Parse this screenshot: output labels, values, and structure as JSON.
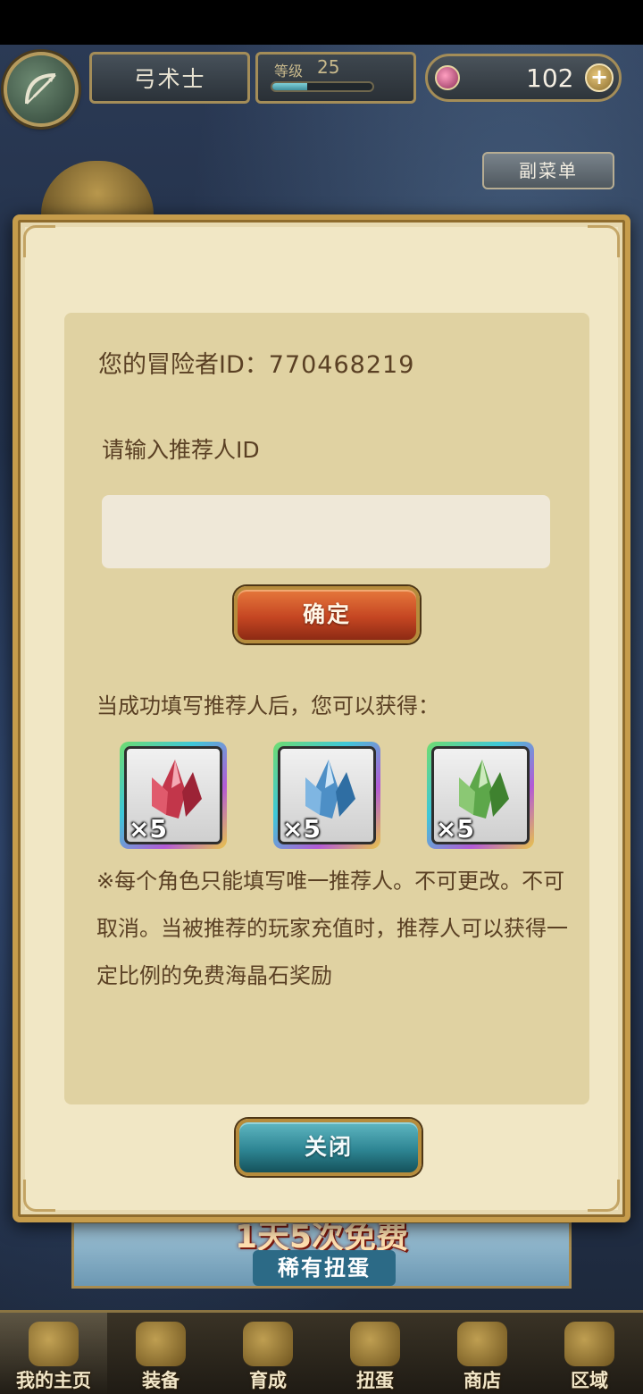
{
  "header": {
    "class_name": "弓术士",
    "level_label": "等级",
    "level_value": "25",
    "level_progress_percent": 35,
    "gems": "102",
    "add_symbol": "+",
    "submenu_label": "副菜单"
  },
  "dialog": {
    "adventurer_label": "您的冒险者ID：",
    "adventurer_id": "770468219",
    "referrer_prompt": "请输入推荐人ID",
    "referrer_input_value": "",
    "confirm_label": "确定",
    "reward_intro": "当成功填写推荐人后，您可以获得：",
    "rewards": [
      {
        "icon": "red-crystal-icon",
        "qty": "×5",
        "color": "#c2364a"
      },
      {
        "icon": "blue-crystal-icon",
        "qty": "×5",
        "color": "#4d8fc6"
      },
      {
        "icon": "green-crystal-icon",
        "qty": "×5",
        "color": "#5da74a"
      }
    ],
    "note": "※每个角色只能填写唯一推荐人。不可更改。不可取消。当被推荐的玩家充值时，推荐人可以获得一定比例的免费海晶石奖励",
    "close_label": "关闭"
  },
  "banner": {
    "title": "1天5次免费",
    "subtitle": "稀有扭蛋"
  },
  "bottom_nav": {
    "items": [
      {
        "label": "我的主页",
        "icon": "scroll-icon"
      },
      {
        "label": "装备",
        "icon": "helmet-icon"
      },
      {
        "label": "育成",
        "icon": "sword-icon"
      },
      {
        "label": "扭蛋",
        "icon": "gacha-icon"
      },
      {
        "label": "商店",
        "icon": "bag-icon"
      },
      {
        "label": "区域",
        "icon": "globe-icon"
      }
    ]
  }
}
